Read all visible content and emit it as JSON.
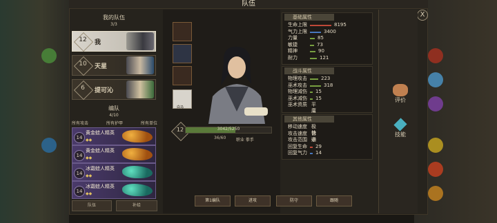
{
  "window": {
    "title": "队伍",
    "close_label": "X"
  },
  "team": {
    "header": "我的队伍",
    "count": "3/3",
    "members": [
      {
        "level": "12",
        "name": "我",
        "selected": true
      },
      {
        "level": "10",
        "name": "天星",
        "selected": false
      },
      {
        "level": "6",
        "name": "提可沁",
        "selected": false
      }
    ]
  },
  "formation": {
    "header": "编队",
    "count": "4/10",
    "filters": [
      "所有攻击",
      "所有护甲",
      "所有单位"
    ],
    "reserves": [
      {
        "level": "14",
        "name": "黄金蛙人精英",
        "stars": "◆◆",
        "color": "#e0902a"
      },
      {
        "level": "14",
        "name": "黄金蛙人精英",
        "stars": "◆◆",
        "color": "#e0902a"
      },
      {
        "level": "14",
        "name": "冰霜蛙人精英",
        "stars": "◆◆",
        "color": "#2ab8a0"
      },
      {
        "level": "14",
        "name": "冰霜蛙人精英",
        "stars": "◆◆",
        "color": "#2ab8a0"
      }
    ],
    "tabs": [
      "队伍",
      "补给"
    ]
  },
  "hero": {
    "level": "12",
    "hp_text": "3042/5250",
    "hp_fraction": 0.58,
    "exp_text": "36/60",
    "profession": "职业 拳手",
    "equip_slots": [
      "weapon",
      "armor",
      "accessory",
      "mount"
    ],
    "mount_label": "白马"
  },
  "stats": {
    "basic": {
      "title": "基础属性",
      "rows": [
        {
          "label": "生命上限",
          "value": "8195",
          "color": "#c04838",
          "frac": 0.85
        },
        {
          "label": "气力上限",
          "value": "3400",
          "color": "#4878c0",
          "frac": 0.45
        },
        {
          "label": "力量",
          "value": "85",
          "color": "#78a040",
          "frac": 0.2
        },
        {
          "label": "敏捷",
          "value": "73",
          "color": "#78a040",
          "frac": 0.18
        },
        {
          "label": "精神",
          "value": "90",
          "color": "#78a040",
          "frac": 0.21
        },
        {
          "label": "耐力",
          "value": "121",
          "color": "#78a040",
          "frac": 0.28
        }
      ]
    },
    "combat": {
      "title": "战斗属性",
      "rows": [
        {
          "label": "物理攻击",
          "value": "223",
          "color": "#78a040",
          "frac": 0.32
        },
        {
          "label": "巫术攻击",
          "value": "318",
          "color": "#78a040",
          "frac": 0.45
        },
        {
          "label": "物理减伤",
          "value": "15",
          "color": "#78a040",
          "frac": 0.1
        },
        {
          "label": "巫术减伤",
          "value": "15",
          "color": "#78a040",
          "frac": 0.1
        },
        {
          "label": "巫术资质",
          "value": "平庸",
          "color": "",
          "frac": 0
        }
      ]
    },
    "other": {
      "title": "其他属性",
      "rows": [
        {
          "label": "移动速度",
          "value": "极快",
          "color": "",
          "frac": 0
        },
        {
          "label": "攻击速度",
          "value": "普通",
          "color": "",
          "frac": 0
        },
        {
          "label": "攻击范围",
          "value": "中",
          "color": "",
          "frac": 0
        },
        {
          "label": "回复生命",
          "value": "29",
          "color": "#c04838",
          "frac": 0.12
        },
        {
          "label": "回复气力",
          "value": "14",
          "color": "#4878c0",
          "frac": 0.06
        }
      ]
    }
  },
  "side_buttons": {
    "comment": "评价",
    "skills": "技能"
  },
  "bottom": {
    "formation_select": "第1编队",
    "attack": "进攻",
    "defend": "防守",
    "follow": "跟随"
  }
}
